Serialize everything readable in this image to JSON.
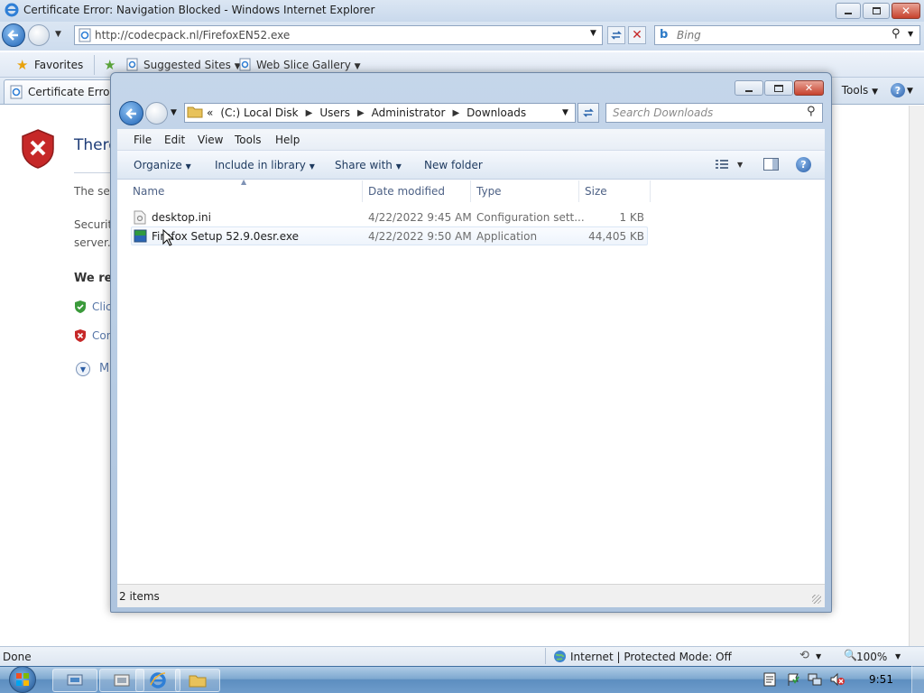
{
  "ie": {
    "title": "Certificate Error: Navigation Blocked - Windows Internet Explorer",
    "url": "http://codecpack.nl/FirefoxEN52.exe",
    "search_placeholder": "Bing",
    "favorites_label": "Favorites",
    "suggested_sites": "Suggested Sites",
    "web_slice_gallery": "Web Slice Gallery",
    "tab_label": "Certificate Error: N",
    "tools_label": "Tools",
    "content": {
      "heading": "There",
      "line1": "The se",
      "line2": "Securit",
      "line3": "server.",
      "bold_line": "We re",
      "option1": "Clic",
      "option2": "Con",
      "more": "M"
    },
    "status": {
      "left": "Done",
      "zone": "Internet | Protected Mode: Off",
      "zoom": "100%"
    }
  },
  "explorer": {
    "breadcrumb": {
      "overflow": "«",
      "items": [
        "(C:) Local Disk",
        "Users",
        "Administrator",
        "Downloads"
      ]
    },
    "search_placeholder": "Search Downloads",
    "menu": [
      "File",
      "Edit",
      "View",
      "Tools",
      "Help"
    ],
    "commands": {
      "organize": "Organize",
      "include": "Include in library",
      "share": "Share with",
      "new_folder": "New folder"
    },
    "columns": [
      "Name",
      "Date modified",
      "Type",
      "Size"
    ],
    "files": [
      {
        "name": "desktop.ini",
        "date": "4/22/2022 9:45 AM",
        "type": "Configuration sett...",
        "size": "1 KB"
      },
      {
        "name": "Firefox Setup 52.9.0esr.exe",
        "date": "4/22/2022 9:50 AM",
        "type": "Application",
        "size": "44,405 KB"
      }
    ],
    "status": "2 items"
  },
  "taskbar": {
    "clock": "9:51"
  },
  "colors": {
    "ie_chrome": "#dbe6f3",
    "explorer_frame": "#b6cbe3",
    "taskbar": "#6f9ccb",
    "link_blue": "#1e3a5f",
    "error_red": "#c62828"
  }
}
